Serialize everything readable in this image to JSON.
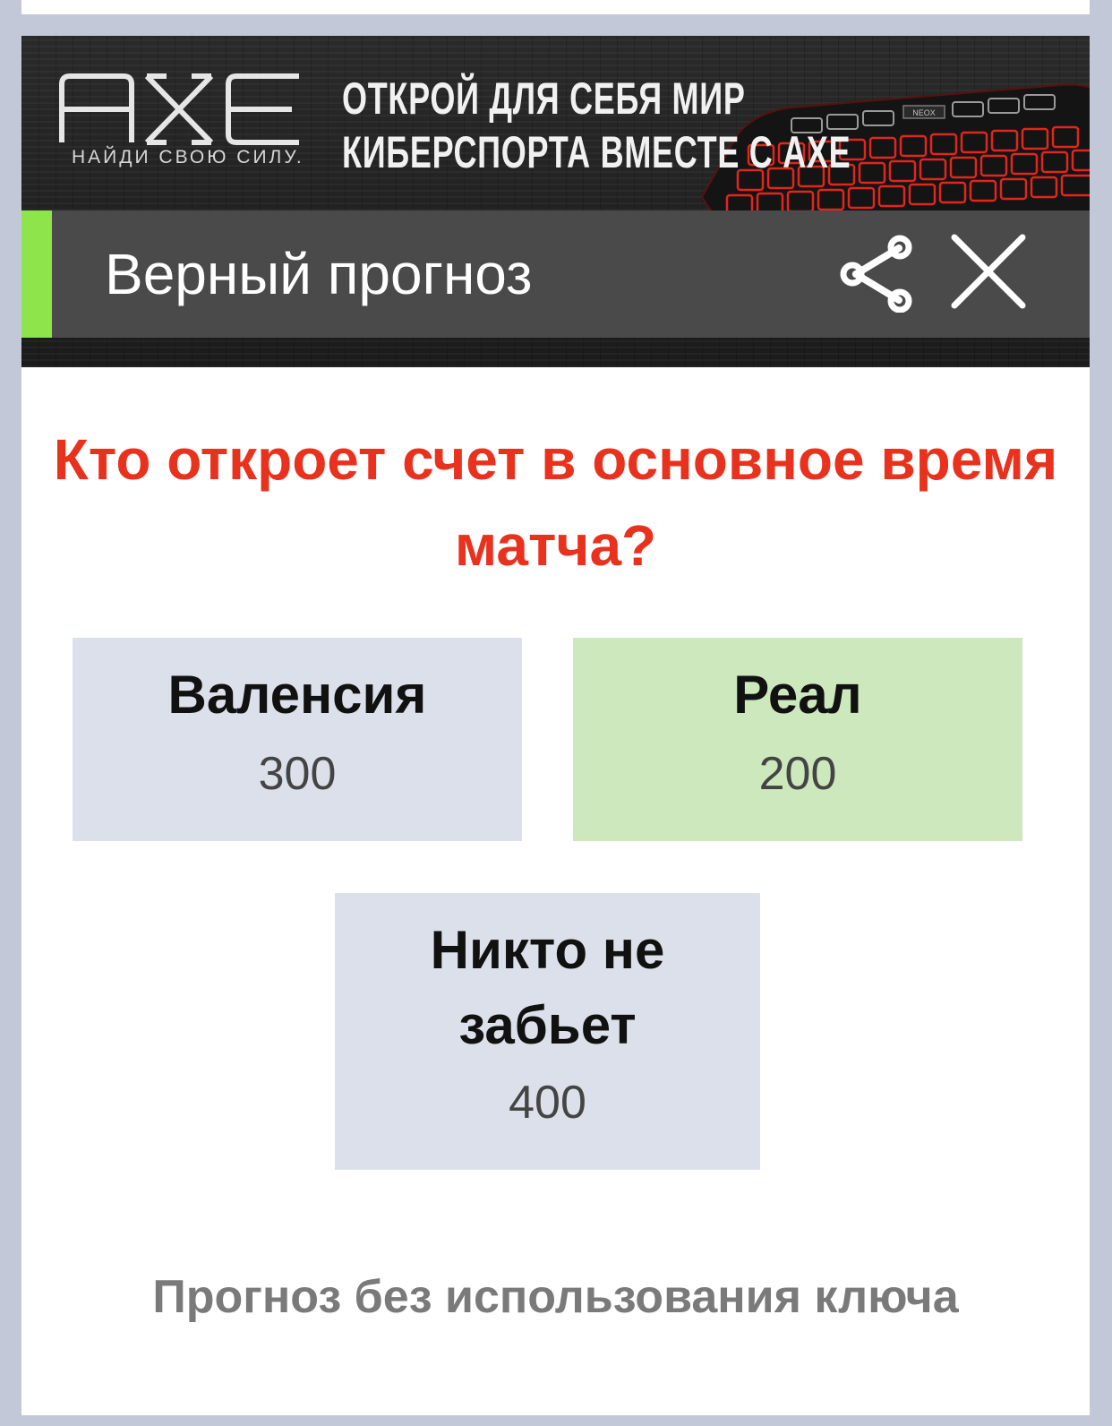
{
  "banner": {
    "brand": "AXE",
    "tagline": "НАЙДИ СВОЮ СИЛУ.",
    "promo_line1": "ОТКРОЙ ДЛЯ СЕБЯ МИР",
    "promo_line2": "КИБЕРСПОРТА ВМЕСТЕ С AXE",
    "keyboard_label": "NEOX"
  },
  "header": {
    "title": "Верный прогноз",
    "share_icon": "share-icon",
    "close_icon": "close-icon",
    "accent_color": "#8ee54b"
  },
  "question": {
    "text": "Кто откроет счет в основное время матча?",
    "color": "#e8321e"
  },
  "options": [
    {
      "label": "Валенсия",
      "count": "300",
      "selected": false,
      "color": "#dbe0ea"
    },
    {
      "label": "Реал",
      "count": "200",
      "selected": true,
      "color": "#cde8bd"
    },
    {
      "label": "Никто не забьет",
      "count": "400",
      "selected": false,
      "color": "#dbe0ea"
    }
  ],
  "footer": {
    "note": "Прогноз без использования ключа"
  }
}
